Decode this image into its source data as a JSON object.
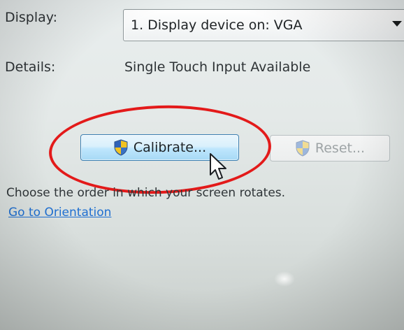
{
  "display": {
    "label": "Display:",
    "selected_value": "1. Display device on: VGA",
    "arrow_icon": "chevron-down-icon"
  },
  "details": {
    "label": "Details:",
    "value": "Single Touch Input Available"
  },
  "buttons": {
    "calibrate_label": "Calibrate...",
    "reset_label": "Reset...",
    "shield_icon": "uac-shield-icon"
  },
  "orientation": {
    "text": "Choose the order in which your screen rotates.",
    "link": "Go to Orientation"
  },
  "colors": {
    "highlight_circle": "#e31a1a",
    "link": "#1f6fd1",
    "button_border": "#3c7fb1"
  }
}
